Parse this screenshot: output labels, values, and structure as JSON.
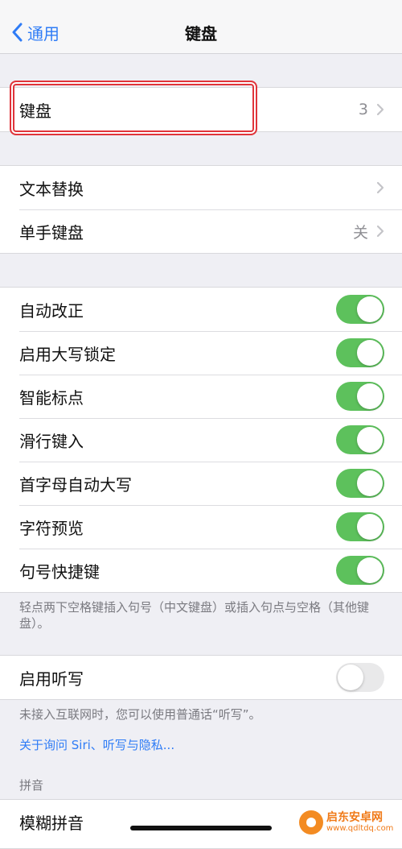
{
  "nav": {
    "back_label": "通用",
    "title": "键盘"
  },
  "group1": {
    "keyboards_label": "键盘",
    "keyboards_value": "3"
  },
  "group2": {
    "text_replacement_label": "文本替换",
    "one_hand_label": "单手键盘",
    "one_hand_value": "关"
  },
  "group3": {
    "items": [
      {
        "label": "自动改正",
        "on": true
      },
      {
        "label": "启用大写锁定",
        "on": true
      },
      {
        "label": "智能标点",
        "on": true
      },
      {
        "label": "滑行键入",
        "on": true
      },
      {
        "label": "首字母自动大写",
        "on": true
      },
      {
        "label": "字符预览",
        "on": true
      },
      {
        "label": "句号快捷键",
        "on": true
      }
    ],
    "note": "轻点两下空格键插入句号（中文键盘）或插入句点与空格（其他键盘）。"
  },
  "dictation": {
    "label": "启用听写",
    "on": false,
    "note": "未接入互联网时，您可以使用普通话“听写”。",
    "link": "关于询问 Siri、听写与隐私..."
  },
  "pinyin": {
    "header": "拼音",
    "fuzzy_label": "模糊拼音"
  },
  "watermark": {
    "main": "启东安卓网",
    "sub": "www.qdltdq.com"
  },
  "colors": {
    "accent": "#2f7cf6",
    "toggle_on": "#5dc15c",
    "highlight": "#e0343a"
  }
}
